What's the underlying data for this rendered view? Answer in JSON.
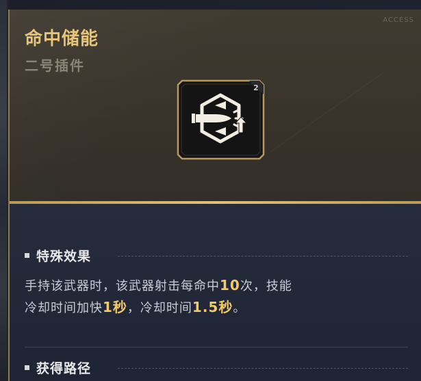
{
  "item": {
    "name": "命中储能",
    "slot": "二号插件",
    "level_badge": "2",
    "corner_tag": "ACCESS"
  },
  "effect_section": {
    "title": "特殊效果",
    "line1_a": "手持该武器时，该武器射击每命中",
    "line1_n": "10",
    "line1_b": "次，技能",
    "line2_a": "冷却时间加快",
    "line2_n": "1秒",
    "line2_b": "，冷却时间",
    "line2_n2": "1.5秒",
    "line2_c": "。"
  },
  "source_section": {
    "title": "获得路径"
  },
  "colors": {
    "accent_gold": "#e6c47a",
    "highlight": "#f1c966",
    "header_bg": "#3b372e",
    "body_bg": "#232a3a"
  },
  "icons": {
    "item_icon": "bullet-hit-energy-icon",
    "bullet": "square-bullet-icon"
  }
}
